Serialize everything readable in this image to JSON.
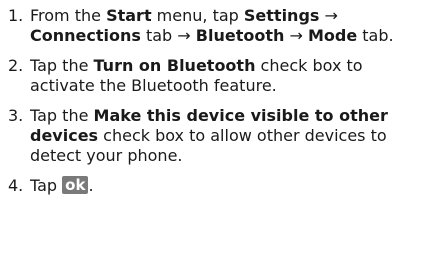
{
  "steps": [
    {
      "number": "1.",
      "parts": [
        "From the ",
        "Start",
        " menu, tap ",
        "Settings",
        " → ",
        "Connections",
        " tab → ",
        "Bluetooth",
        " → ",
        "Mode",
        " tab."
      ]
    },
    {
      "number": "2.",
      "parts": [
        "Tap the ",
        "Turn on Bluetooth",
        " check box to activate the Bluetooth feature."
      ]
    },
    {
      "number": "3.",
      "parts": [
        "Tap the ",
        "Make this device visible to other devices",
        " check box to allow other devices to detect your phone."
      ]
    },
    {
      "number": "4.",
      "parts": [
        "Tap ",
        "ok",
        "."
      ]
    }
  ],
  "colors": {
    "ok_button_bg": "#7a7a7a",
    "ok_button_text": "#ffffff"
  }
}
